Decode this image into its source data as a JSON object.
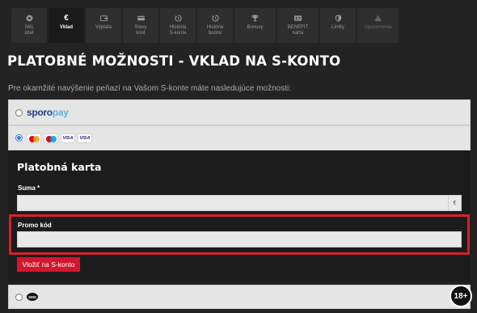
{
  "tabs": [
    {
      "label": "Môj\núčet",
      "icon": "gear-icon"
    },
    {
      "label": "Vklad",
      "icon": "euro-icon"
    },
    {
      "label": "Výplata",
      "icon": "wallet-icon"
    },
    {
      "label": "Stavy\nkont",
      "icon": "card-icon"
    },
    {
      "label": "História\nS-konta",
      "icon": "history-icon"
    },
    {
      "label": "História\nbodov",
      "icon": "history-icon"
    },
    {
      "label": "Bonusy",
      "icon": "trophy-icon"
    },
    {
      "label": "BENEFIT\nkarta",
      "icon": "id-card-icon"
    },
    {
      "label": "Limity",
      "icon": "shield-icon"
    },
    {
      "label": "Upozornenia",
      "icon": "warning-icon"
    }
  ],
  "page": {
    "title": "PLATOBNÉ MOŽNOSTI - VKLAD NA S-KONTO",
    "intro": "Pre okamžité navýšenie peňazí na Vašom S-konte máte nasledujúce možnosti:"
  },
  "options": {
    "sporopay_a": "sporo",
    "sporopay_b": "pay",
    "card_logos": [
      "VISA",
      "VISA"
    ],
    "sms_label": "SMS"
  },
  "card_panel": {
    "title": "Platobná karta",
    "amount_label": "Suma *",
    "amount_suffix": "€",
    "promo_label": "Promo kód",
    "submit_label": "Vložiť na S-konto"
  },
  "age_badge": "18+",
  "colors": {
    "accent_red": "#d4162c",
    "highlight_red": "#d8202a",
    "radio_blue": "#3a7bd5"
  }
}
